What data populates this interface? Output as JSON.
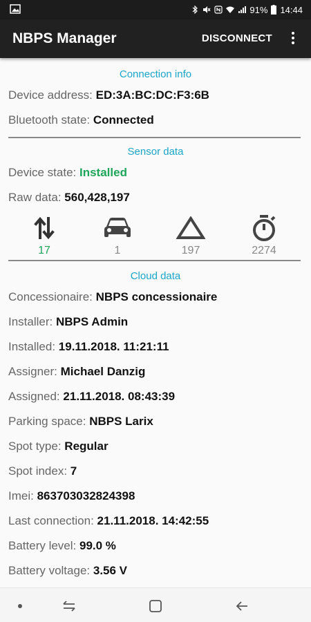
{
  "status_bar": {
    "battery_percent": "91%",
    "time": "14:44"
  },
  "app_bar": {
    "title": "NBPS Manager",
    "action_label": "DISCONNECT"
  },
  "connection_info": {
    "title": "Connection info",
    "rows": [
      {
        "label": "Device address:",
        "value": "ED:3A:BC:DC:F3:6B"
      },
      {
        "label": "Bluetooth state:",
        "value": "Connected"
      }
    ]
  },
  "sensor_data": {
    "title": "Sensor data",
    "device_state_label": "Device state:",
    "device_state_value": "Installed",
    "raw_data_label": "Raw data:",
    "raw_data_value": "560,428,197",
    "metrics": [
      {
        "icon": "swap-vertical-icon",
        "value": "17",
        "color": "#1ea65a"
      },
      {
        "icon": "car-icon",
        "value": "1",
        "color": "#888888"
      },
      {
        "icon": "triangle-icon",
        "value": "197",
        "color": "#888888"
      },
      {
        "icon": "stopwatch-icon",
        "value": "2274",
        "color": "#888888"
      }
    ]
  },
  "cloud_data": {
    "title": "Cloud data",
    "rows": [
      {
        "label": "Concessionaire:",
        "value": "NBPS concessionaire"
      },
      {
        "label": "Installer:",
        "value": "NBPS Admin"
      },
      {
        "label": "Installed:",
        "value": "19.11.2018. 11:21:11"
      },
      {
        "label": "Assigner:",
        "value": "Michael Danzig"
      },
      {
        "label": "Assigned:",
        "value": "21.11.2018. 08:43:39"
      },
      {
        "label": "Parking space:",
        "value": "NBPS Larix"
      },
      {
        "label": "Spot type:",
        "value": "Regular"
      },
      {
        "label": "Spot index:",
        "value": "7"
      },
      {
        "label": "Imei:",
        "value": "863703032824398"
      },
      {
        "label": "Last connection:",
        "value": "21.11.2018. 14:42:55"
      },
      {
        "label": "Battery level:",
        "value": "99.0 %"
      },
      {
        "label": "Battery voltage:",
        "value": "3.56 V"
      }
    ]
  },
  "colors": {
    "accent": "#1aa6c8",
    "ok": "#1ea65a",
    "app_bar": "#212121"
  }
}
